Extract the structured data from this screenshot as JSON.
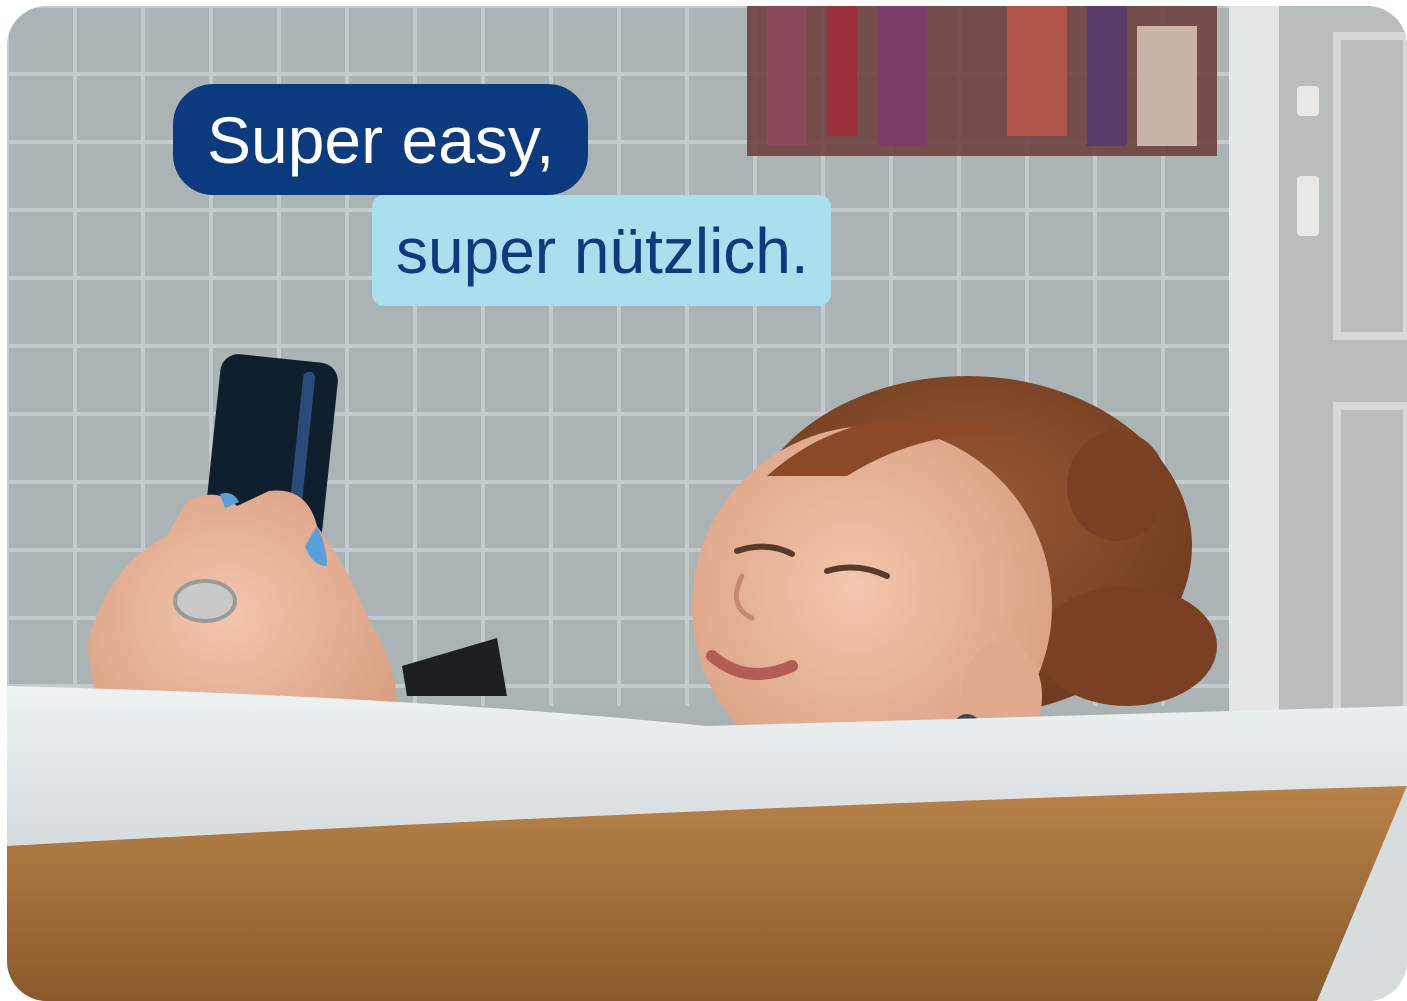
{
  "headline": {
    "line1": "Super easy,",
    "line2": "super nützlich."
  },
  "colors": {
    "pill1_bg": "#0b3a7e",
    "pill1_text": "#ffffff",
    "pill2_bg": "#a8e0ee",
    "pill2_text": "#0b3a7e"
  },
  "photo": {
    "subject": "woman-in-bathtub-with-smartphone"
  }
}
